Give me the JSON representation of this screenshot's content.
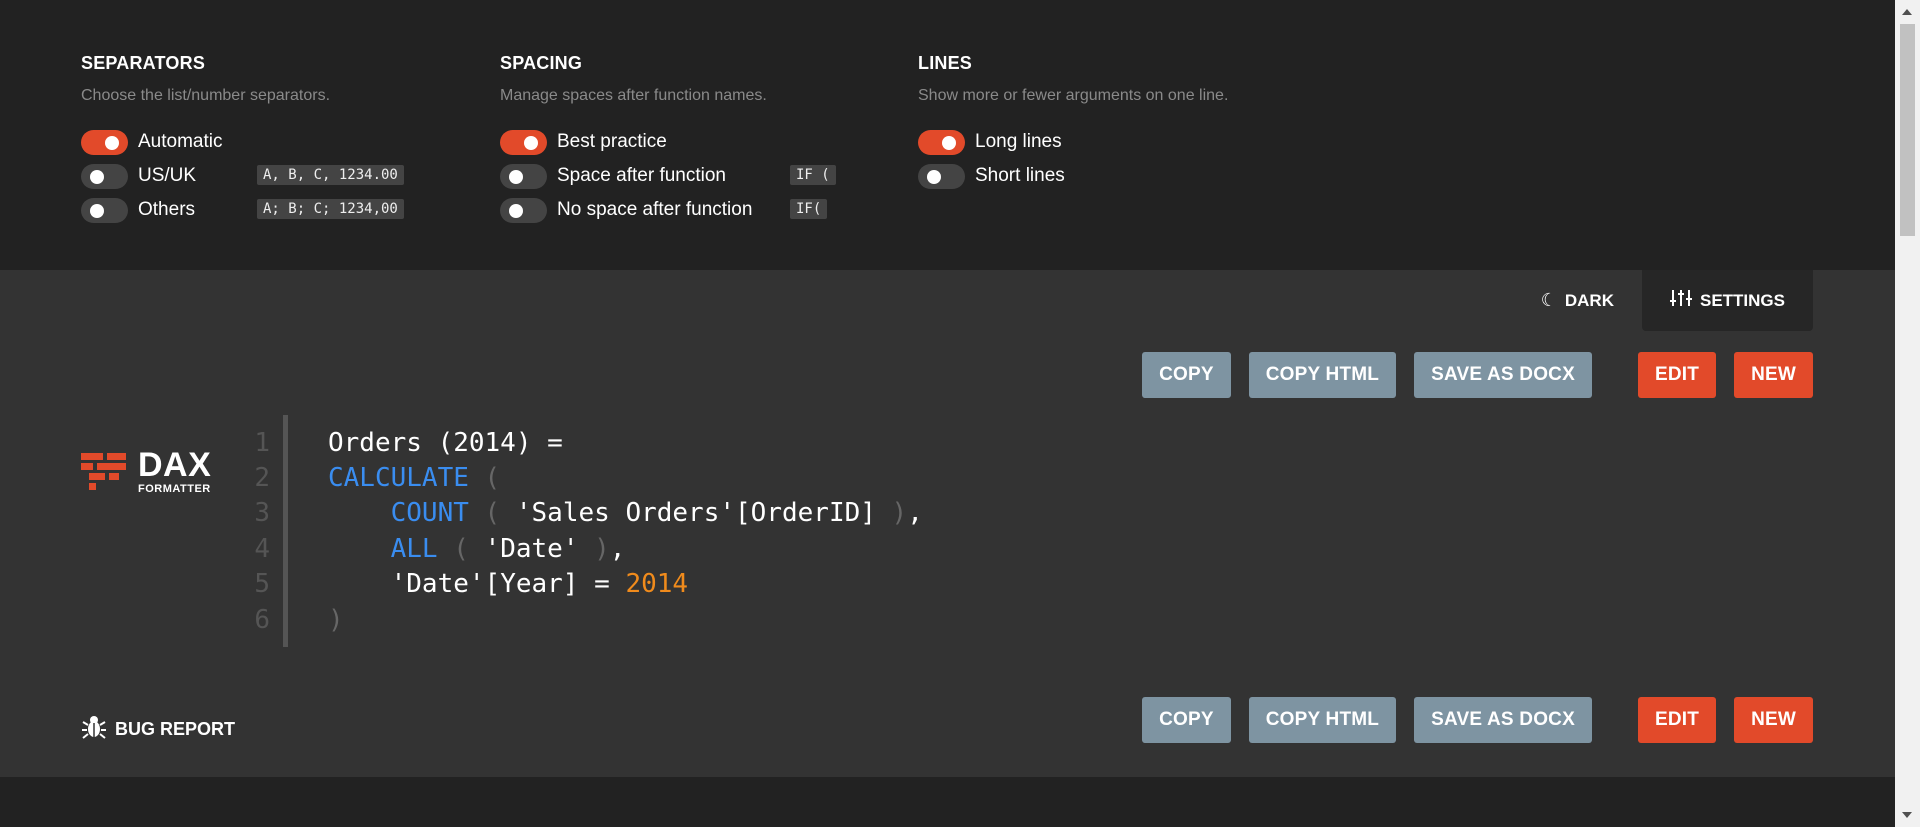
{
  "settings": {
    "separators": {
      "title": "SEPARATORS",
      "description": "Choose the list/number separators.",
      "options": [
        {
          "label": "Automatic",
          "on": true,
          "example": ""
        },
        {
          "label": "US/UK",
          "on": false,
          "example": "A, B, C, 1234.00"
        },
        {
          "label": "Others",
          "on": false,
          "example": "A; B; C; 1234,00"
        }
      ]
    },
    "spacing": {
      "title": "SPACING",
      "description": "Manage spaces after function names.",
      "options": [
        {
          "label": "Best practice",
          "on": true,
          "example": ""
        },
        {
          "label": "Space after function",
          "on": false,
          "example": "IF ("
        },
        {
          "label": "No space after function",
          "on": false,
          "example": "IF("
        }
      ]
    },
    "lines": {
      "title": "LINES",
      "description": "Show more or fewer arguments on one line.",
      "options": [
        {
          "label": "Long lines",
          "on": true
        },
        {
          "label": "Short lines",
          "on": false
        }
      ]
    }
  },
  "tabs": {
    "dark_label": "DARK",
    "settings_label": "SETTINGS"
  },
  "toolbar": {
    "copy": "COPY",
    "copy_html": "COPY HTML",
    "save_docx": "SAVE AS DOCX",
    "edit": "EDIT",
    "new": "NEW"
  },
  "logo": {
    "title": "DAX",
    "subtitle": "FORMATTER"
  },
  "code": {
    "line_numbers": [
      "1",
      "2",
      "3",
      "4",
      "5",
      "6"
    ],
    "l1": "Orders (2014) =",
    "l2_fn": "CALCULATE",
    "l2_paren": " (",
    "l3_fn": "COUNT",
    "l3_open": " ( ",
    "l3_arg": "'Sales Orders'[OrderID]",
    "l3_close": " )",
    "l3_comma": ",",
    "l4_fn": "ALL",
    "l4_open": " ( ",
    "l4_arg": "'Date'",
    "l4_close": " )",
    "l4_comma": ",",
    "l5_col": "'Date'[Year] = ",
    "l5_num": "2014",
    "l6": ")"
  },
  "bug_report": "BUG REPORT",
  "colors": {
    "accent": "#e24a2a",
    "button_gray": "#7e94a2",
    "keyword": "#3a8df0",
    "number": "#f08b1c"
  }
}
